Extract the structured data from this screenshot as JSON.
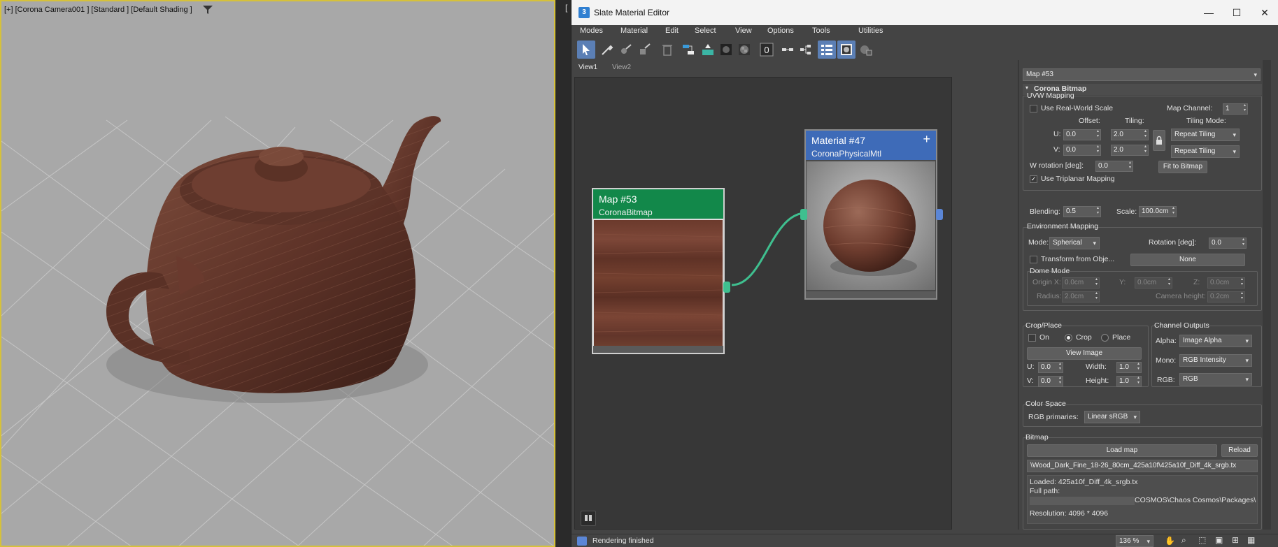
{
  "viewport": {
    "label": "[+] [Corona Camera001 ] [Standard ] [Default Shading ]"
  },
  "divider_mark": "[",
  "window": {
    "title": "Slate Material Editor",
    "icon_glyph": "3",
    "minimize": "—",
    "maximize": "☐",
    "close": "✕"
  },
  "menu": [
    "Modes",
    "Material",
    "Edit",
    "Select",
    "View",
    "Options",
    "Tools",
    "Utilities"
  ],
  "toolbar": {
    "icons": [
      "select-arrow-icon",
      "eyedropper-icon",
      "pick-material-icon",
      "put-material-icon",
      "delete-icon",
      "layout-icon",
      "assign-icon",
      "show-background-icon",
      "checker-icon",
      "zero-icon",
      "hide-slots-icon",
      "tree-layout-icon",
      "list-icon",
      "preview-icon",
      "material-map-icon"
    ],
    "zero_label": "0"
  },
  "tabs": [
    "View1",
    "View2"
  ],
  "nodes": {
    "map": {
      "title": "Map #53",
      "subtitle": "CoronaBitmap",
      "header_color": "#12884a"
    },
    "material": {
      "title": "Material #47",
      "subtitle": "CoronaPhysicalMtl",
      "header_color": "#3e6bb8",
      "add_glyph": "+"
    }
  },
  "panel": {
    "selector": "Map #53",
    "rollout_title": "Corona Bitmap",
    "uvw": {
      "title": "UVW Mapping",
      "use_real_world": "Use Real-World Scale",
      "map_channel_label": "Map Channel:",
      "map_channel": "1",
      "offset_label": "Offset:",
      "tiling_label": "Tiling:",
      "tiling_mode_label": "Tiling Mode:",
      "u_label": "U:",
      "v_label": "V:",
      "u_offset": "0.0",
      "v_offset": "0.0",
      "u_tiling": "2.0",
      "v_tiling": "2.0",
      "u_mode": "Repeat Tiling",
      "v_mode": "Repeat Tiling",
      "w_rotation_label": "W rotation [deg]:",
      "w_rotation": "0.0",
      "fit_bitmap": "Fit to Bitmap",
      "use_triplanar": "Use Triplanar Mapping",
      "triplanar_checked": true,
      "blending_label": "Blending:",
      "blending": "0.5",
      "scale_label": "Scale:",
      "scale": "100.0cm"
    },
    "env": {
      "title": "Environment Mapping",
      "mode_label": "Mode:",
      "mode": "Spherical",
      "rotation_label": "Rotation [deg]:",
      "rotation": "0.0",
      "transform_label": "Transform from Obje...",
      "none_button": "None",
      "dome_title": "Dome Mode",
      "origin_x_label": "Origin X:",
      "origin_x": "0.0cm",
      "y_label": "Y:",
      "y": "0.0cm",
      "z_label": "Z:",
      "z": "0.0cm",
      "radius_label": "Radius:",
      "radius": "2.0cm",
      "camera_height_label": "Camera height:",
      "camera_height": "0.2cm"
    },
    "crop": {
      "title": "Crop/Place",
      "on": "On",
      "crop": "Crop",
      "place": "Place",
      "view_image": "View Image",
      "u_label": "U:",
      "u": "0.0",
      "width_label": "Width:",
      "width": "1.0",
      "v_label": "V:",
      "v": "0.0",
      "height_label": "Height:",
      "height": "1.0"
    },
    "outputs": {
      "title": "Channel Outputs",
      "alpha_label": "Alpha:",
      "alpha": "Image Alpha",
      "mono_label": "Mono:",
      "mono": "RGB Intensity",
      "rgb_label": "RGB:",
      "rgb": "RGB"
    },
    "color_space": {
      "title": "Color Space",
      "primaries_label": "RGB primaries:",
      "primaries": "Linear sRGB"
    },
    "bitmap": {
      "title": "Bitmap",
      "load_map": "Load map",
      "reload": "Reload",
      "path": "\\Wood_Dark_Fine_18-26_80cm_425a10f\\425a10f_Diff_4k_srgb.tx",
      "loaded": "Loaded: 425a10f_Diff_4k_srgb.tx",
      "full_path_label": "Full path:",
      "full_path_tail": "COSMOS\\Chaos Cosmos\\Packages\\",
      "resolution": "Resolution: 4096 * 4096"
    }
  },
  "status": {
    "text": "Rendering finished",
    "zoom": "136 %"
  }
}
